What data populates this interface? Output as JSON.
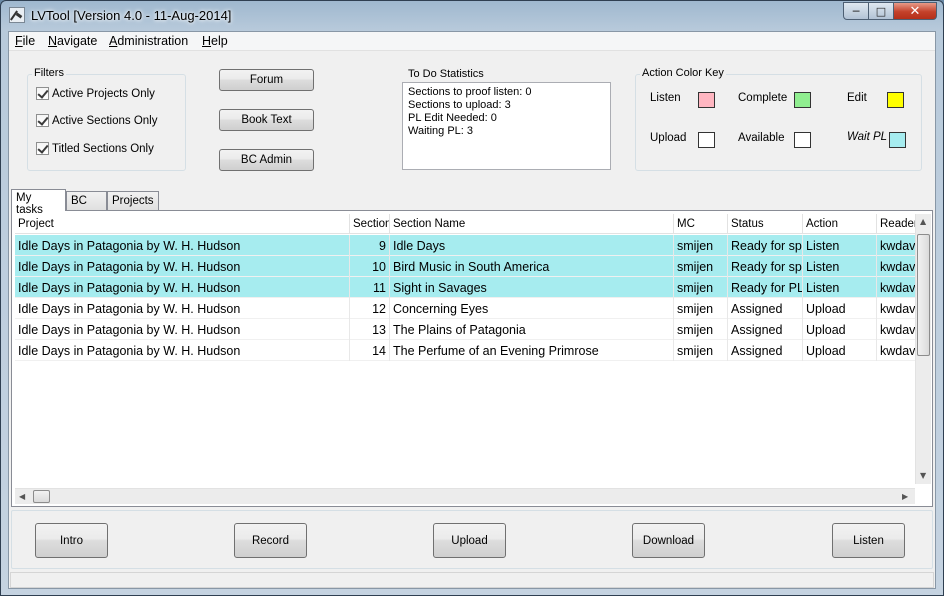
{
  "window": {
    "title": "LVTool [Version 4.0 - 11-Aug-2014]",
    "minimize_glyph": "─",
    "maximize_glyph": "□",
    "close_glyph": "✕"
  },
  "menu": {
    "items": [
      {
        "accel": "F",
        "rest": "ile"
      },
      {
        "accel": "N",
        "rest": "avigate"
      },
      {
        "accel": "A",
        "rest": "dministration"
      },
      {
        "accel": "H",
        "rest": "elp"
      }
    ]
  },
  "filters": {
    "legend": "Filters",
    "options": [
      {
        "label": "Active Projects Only",
        "checked": true
      },
      {
        "label": "Active Sections Only",
        "checked": true
      },
      {
        "label": "Titled Sections Only",
        "checked": true
      }
    ]
  },
  "links": {
    "forum": "Forum",
    "book_text": "Book Text",
    "bc_admin": "BC Admin"
  },
  "todo": {
    "legend": "To Do Statistics",
    "lines": [
      "Sections to proof listen: 0",
      "Sections to upload: 3",
      "PL Edit Needed: 0",
      "Waiting PL: 3"
    ]
  },
  "color_key": {
    "legend": "Action Color Key",
    "items": [
      {
        "label": "Listen",
        "color": "#ffb6c1"
      },
      {
        "label": "Complete",
        "color": "#90ee90"
      },
      {
        "label": "Edit",
        "color": "#ffff00"
      },
      {
        "label": "Upload",
        "color": "#ffffff"
      },
      {
        "label": "Available",
        "color": "#ffffff"
      },
      {
        "label": "Wait PL",
        "color": "#a6ecef"
      }
    ]
  },
  "tabs": [
    "My tasks",
    "BC",
    "Projects"
  ],
  "grid": {
    "highlight_color": "#a6ecef",
    "columns": [
      "Project",
      "Section",
      "Section Name",
      "MC",
      "Status",
      "Action",
      "Reader"
    ],
    "rows": [
      {
        "project": "Idle Days in Patagonia by W. H. Hudson",
        "section": "9",
        "name": "Idle Days",
        "mc": "smijen",
        "status": "Ready for spot check",
        "action": "Listen",
        "reader": "kwdavids",
        "highlight": true
      },
      {
        "project": "Idle Days in Patagonia by W. H. Hudson",
        "section": "10",
        "name": "Bird Music in South America",
        "mc": "smijen",
        "status": "Ready for spot check",
        "action": "Listen",
        "reader": "kwdavids",
        "highlight": true
      },
      {
        "project": "Idle Days in Patagonia by W. H. Hudson",
        "section": "11",
        "name": "Sight in Savages",
        "mc": "smijen",
        "status": "Ready for PL",
        "action": "Listen",
        "reader": "kwdavids",
        "highlight": true
      },
      {
        "project": "Idle Days in Patagonia by W. H. Hudson",
        "section": "12",
        "name": "Concerning Eyes",
        "mc": "smijen",
        "status": "Assigned",
        "action": "Upload",
        "reader": "kwdavids",
        "highlight": false
      },
      {
        "project": "Idle Days in Patagonia by W. H. Hudson",
        "section": "13",
        "name": "The Plains of Patagonia",
        "mc": "smijen",
        "status": "Assigned",
        "action": "Upload",
        "reader": "kwdavids",
        "highlight": false
      },
      {
        "project": "Idle Days in Patagonia by W. H. Hudson",
        "section": "14",
        "name": "The Perfume of an Evening Primrose",
        "mc": "smijen",
        "status": "Assigned",
        "action": "Upload",
        "reader": "kwdavids",
        "highlight": false
      }
    ]
  },
  "scroll_arrows": {
    "up": "▲",
    "down": "▼",
    "left": "◀",
    "right": "▶"
  },
  "actions": [
    "Intro",
    "Record",
    "Upload",
    "Download",
    "Listen"
  ]
}
